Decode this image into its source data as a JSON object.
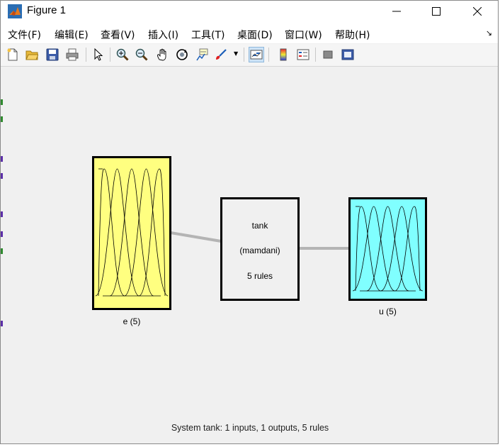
{
  "window": {
    "title": "Figure 1"
  },
  "menu": {
    "items": [
      "文件(F)",
      "编辑(E)",
      "查看(V)",
      "插入(I)",
      "工具(T)",
      "桌面(D)",
      "窗口(W)",
      "帮助(H)"
    ]
  },
  "toolbar": {
    "icons": [
      "new-file-icon",
      "open-folder-icon",
      "save-icon",
      "print-icon",
      "pointer-icon",
      "zoom-in-icon",
      "zoom-out-icon",
      "pan-hand-icon",
      "rotate-3d-icon",
      "data-cursor-icon",
      "brush-icon",
      "link-plot-icon",
      "colorbar-icon",
      "legend-icon",
      "hide-plot-tools-icon",
      "show-plot-tools-icon"
    ]
  },
  "diagram": {
    "input": {
      "label": "e (5)",
      "color": "#ffff80",
      "mf_count": 5
    },
    "system": {
      "name": "tank",
      "type": "(mamdani)",
      "rules": "5 rules",
      "color": "#f0f0f0"
    },
    "output": {
      "label": "u (5)",
      "color": "#80ffff",
      "mf_count": 5
    },
    "status": "System tank: 1 inputs, 1 outputs, 5 rules"
  },
  "colors": {
    "accent": "#0b61a4",
    "connector": "#b4b4b4"
  }
}
